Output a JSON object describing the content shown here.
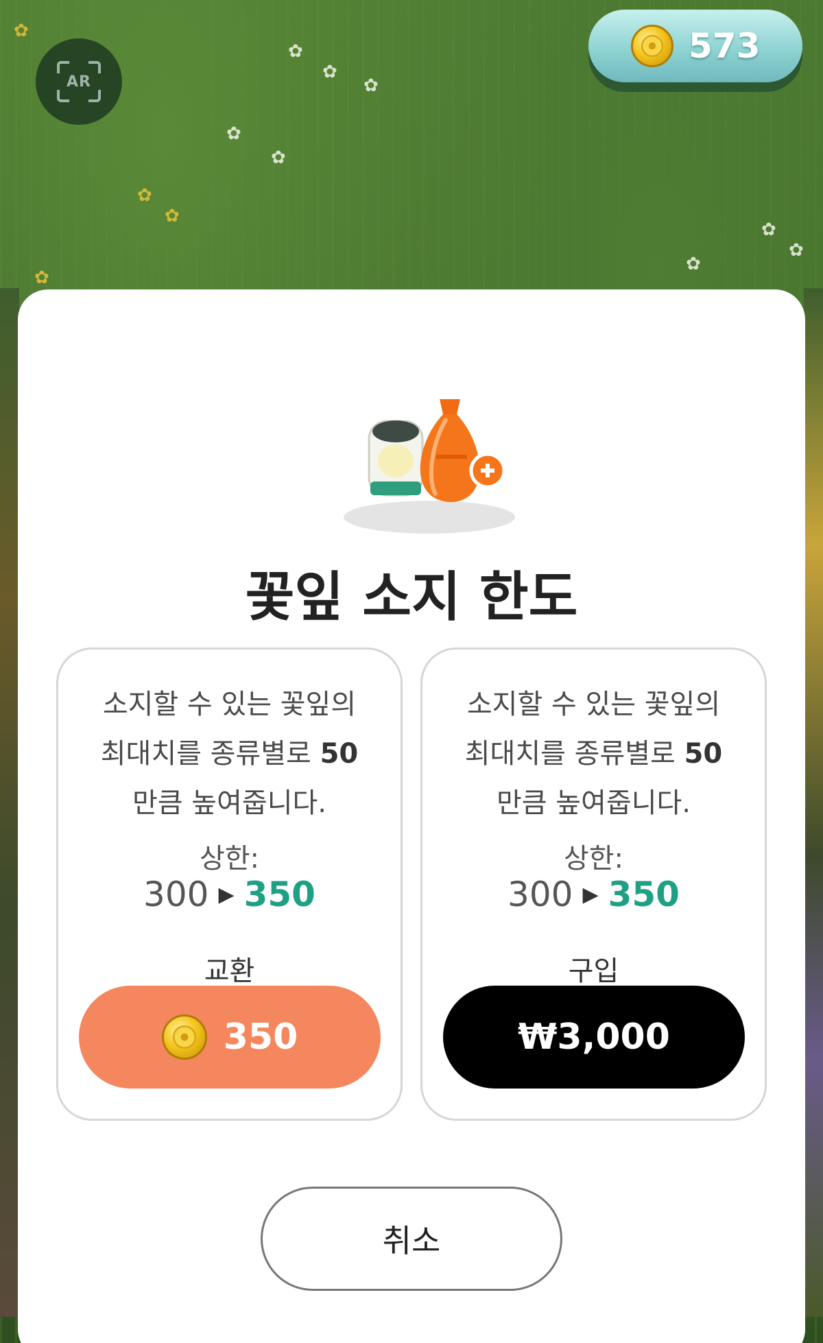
{
  "header": {
    "ar_label": "AR",
    "coin_count": "573"
  },
  "dialog": {
    "title": "꽃잎 소지 한도",
    "illustration_icons": [
      "petal-jar-icon",
      "orange-pouch-icon",
      "plus-badge-icon"
    ],
    "cards": [
      {
        "description_lines": [
          "소지할 수 있는 꽃잎의",
          "최대치를 종류별로",
          "만큼 높여줍니다."
        ],
        "increase_amount": "50",
        "limit_label": "상한:",
        "limit_current": "300",
        "limit_new": "350",
        "action_label": "교환",
        "button_value": "350",
        "button_icon": "coin-icon"
      },
      {
        "description_lines": [
          "소지할 수 있는 꽃잎의",
          "최대치를 종류별로",
          "만큼 높여줍니다."
        ],
        "increase_amount": "50",
        "limit_label": "상한:",
        "limit_current": "300",
        "limit_new": "350",
        "action_label": "구입",
        "button_value": "₩3,000"
      }
    ],
    "cancel_label": "취소"
  },
  "colors": {
    "exchange_button": "#f5875e",
    "buy_button": "#000000",
    "highlight_green": "#1fa084",
    "coin_pill": "#8fd3d3"
  }
}
